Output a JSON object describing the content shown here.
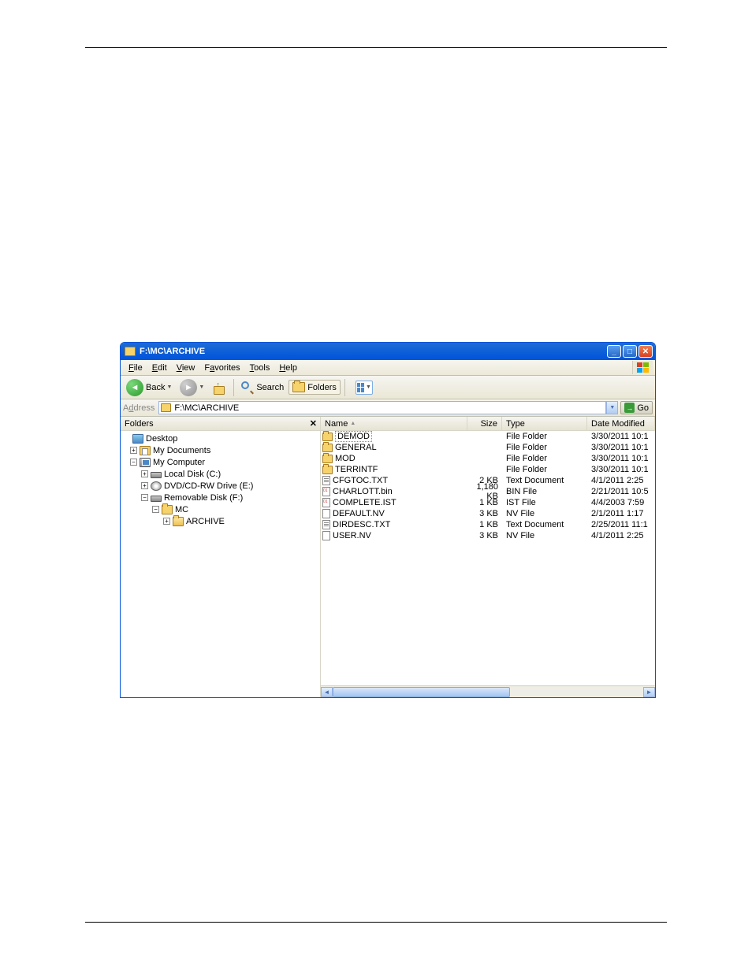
{
  "titlebar": {
    "title": "F:\\MC\\ARCHIVE"
  },
  "menu": {
    "file": "File",
    "edit": "Edit",
    "view": "View",
    "favorites": "Favorites",
    "tools": "Tools",
    "help": "Help"
  },
  "toolbar": {
    "back": "Back",
    "search": "Search",
    "folders": "Folders"
  },
  "address": {
    "label": "Address",
    "value": "F:\\MC\\ARCHIVE",
    "go": "Go"
  },
  "sidebar": {
    "title": "Folders",
    "tree": {
      "desktop": "Desktop",
      "mydocs": "My Documents",
      "mycomputer": "My Computer",
      "localc": "Local Disk (C:)",
      "dvd": "DVD/CD-RW Drive (E:)",
      "removable": "Removable Disk (F:)",
      "mc": "MC",
      "archive": "ARCHIVE"
    }
  },
  "columns": {
    "name": "Name",
    "size": "Size",
    "type": "Type",
    "date": "Date Modified"
  },
  "files": [
    {
      "name": "DEMOD",
      "size": "",
      "type": "File Folder",
      "date": "3/30/2011 10:1",
      "icon": "folder",
      "sel": true
    },
    {
      "name": "GENERAL",
      "size": "",
      "type": "File Folder",
      "date": "3/30/2011 10:1",
      "icon": "folder"
    },
    {
      "name": "MOD",
      "size": "",
      "type": "File Folder",
      "date": "3/30/2011 10:1",
      "icon": "folder"
    },
    {
      "name": "TERRINTF",
      "size": "",
      "type": "File Folder",
      "date": "3/30/2011 10:1",
      "icon": "folder"
    },
    {
      "name": "CFGTOC.TXT",
      "size": "2 KB",
      "type": "Text Document",
      "date": "4/1/2011 2:25",
      "icon": "txt"
    },
    {
      "name": "CHARLOTT.bin",
      "size": "1,180 KB",
      "type": "BIN File",
      "date": "2/21/2011 10:5",
      "icon": "bin"
    },
    {
      "name": "COMPLETE.IST",
      "size": "1 KB",
      "type": "IST File",
      "date": "4/4/2003 7:59",
      "icon": "bin"
    },
    {
      "name": "DEFAULT.NV",
      "size": "3 KB",
      "type": "NV File",
      "date": "2/1/2011 1:17",
      "icon": "generic"
    },
    {
      "name": "DIRDESC.TXT",
      "size": "1 KB",
      "type": "Text Document",
      "date": "2/25/2011 11:1",
      "icon": "txt"
    },
    {
      "name": "USER.NV",
      "size": "3 KB",
      "type": "NV File",
      "date": "4/1/2011 2:25",
      "icon": "generic"
    }
  ]
}
